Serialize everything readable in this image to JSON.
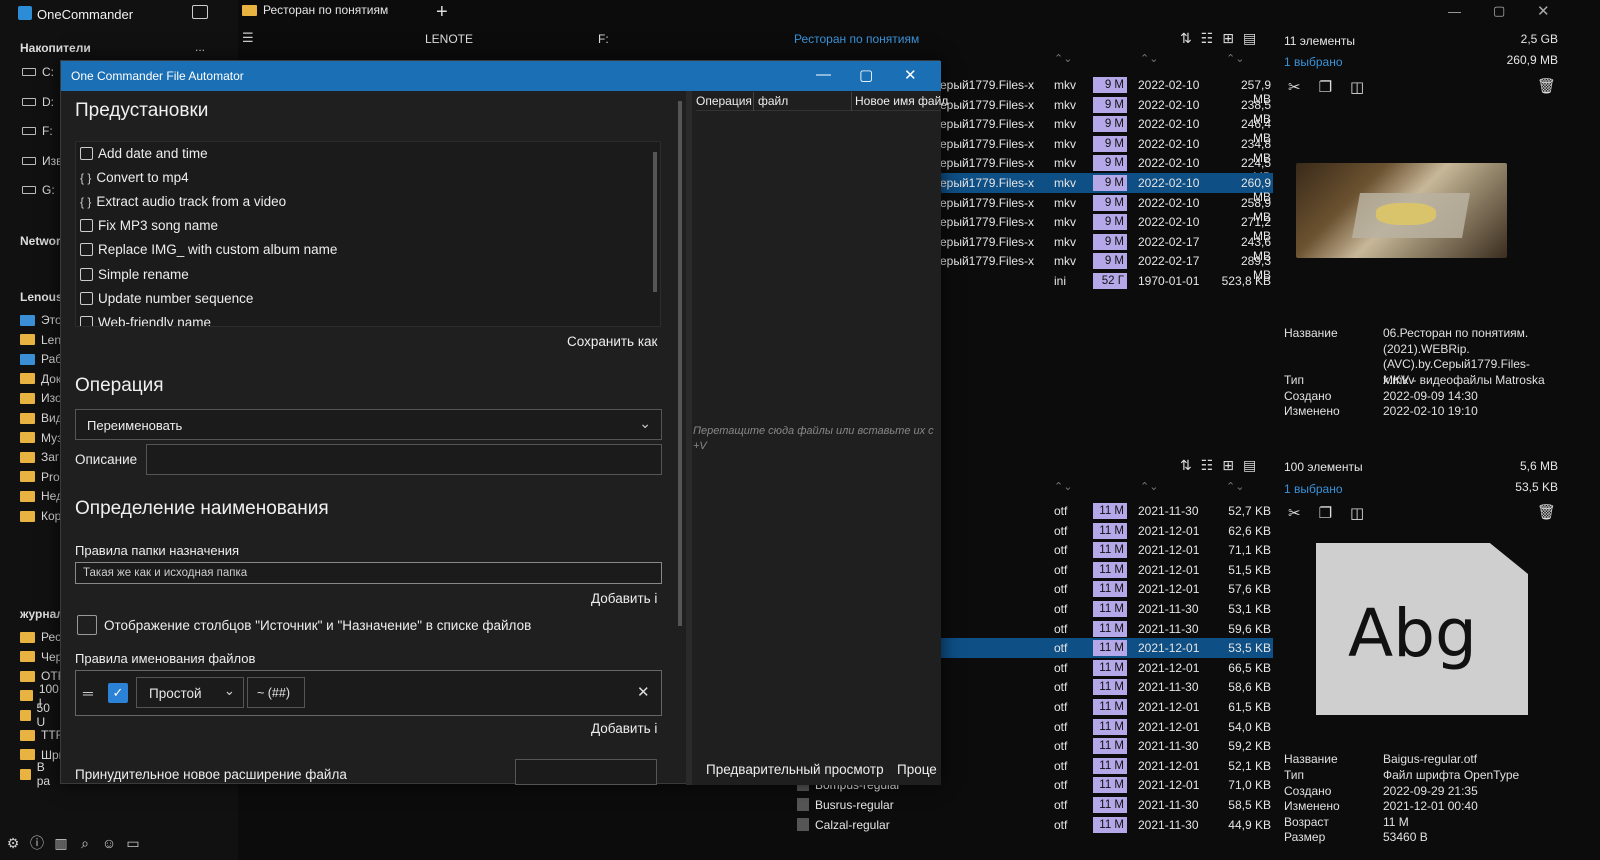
{
  "app": {
    "title": "OneCommander"
  },
  "sidebar": {
    "drives_header": "Накопители",
    "drives_more": "...",
    "drives": [
      {
        "letter": "C:"
      },
      {
        "letter": "D:"
      },
      {
        "letter": "F:"
      },
      {
        "letter": "Изв"
      },
      {
        "letter": "G:"
      }
    ],
    "network_header": "Networ",
    "pc_header": "Lenous",
    "pc_items": [
      "Этот",
      "Leno",
      "Рабо",
      "Доку",
      "Изоб",
      "Виде",
      "Музы",
      "Загр",
      "Prog",
      "Недa",
      "Корз"
    ],
    "journal_header": "журнал",
    "journal_items": [
      "Рест",
      "Черн",
      "OTF",
      "100 l",
      "50 U",
      "TTF-",
      "Шри",
      "В ра"
    ]
  },
  "tabs": [
    {
      "label": "Ресторан по понятиям"
    }
  ],
  "panes": {
    "col1": "LENOTE",
    "col2": "F:",
    "col3_path": "Ресторан по понятиям"
  },
  "top_list": {
    "count": "11 элементы",
    "selected": "1 выбрано",
    "total_size": "2,5 GB",
    "sel_size": "260,9 MB",
    "rows": [
      {
        "name": "ерый1779.Files-x",
        "ext": "mkv",
        "age": "9 M",
        "date": "2022-02-10",
        "size": "257,9 MB",
        "sel": false
      },
      {
        "name": "ерый1779.Files-x",
        "ext": "mkv",
        "age": "9 M",
        "date": "2022-02-10",
        "size": "238,5 MB",
        "sel": false
      },
      {
        "name": "ерый1779.Files-x",
        "ext": "mkv",
        "age": "9 M",
        "date": "2022-02-10",
        "size": "246,4 MB",
        "sel": false
      },
      {
        "name": "ерый1779.Files-x",
        "ext": "mkv",
        "age": "9 M",
        "date": "2022-02-10",
        "size": "234,8 MB",
        "sel": false
      },
      {
        "name": "ерый1779.Files-x",
        "ext": "mkv",
        "age": "9 M",
        "date": "2022-02-10",
        "size": "224,5 MB",
        "sel": false
      },
      {
        "name": "ерый1779.Files-x",
        "ext": "mkv",
        "age": "9 M",
        "date": "2022-02-10",
        "size": "260,9 MB",
        "sel": true
      },
      {
        "name": "ерый1779.Files-x",
        "ext": "mkv",
        "age": "9 M",
        "date": "2022-02-10",
        "size": "258,9 MB",
        "sel": false
      },
      {
        "name": "ерый1779.Files-x",
        "ext": "mkv",
        "age": "9 M",
        "date": "2022-02-10",
        "size": "271,2 MB",
        "sel": false
      },
      {
        "name": "ерый1779.Files-x",
        "ext": "mkv",
        "age": "9 M",
        "date": "2022-02-17",
        "size": "243,6 MB",
        "sel": false
      },
      {
        "name": "ерый1779.Files-x",
        "ext": "mkv",
        "age": "9 M",
        "date": "2022-02-17",
        "size": "289,3 MB",
        "sel": false
      },
      {
        "name": "",
        "ext": "ini",
        "age": "52 Г",
        "date": "1970-01-01",
        "size": "523,8 KB",
        "sel": false
      }
    ]
  },
  "top_info": {
    "name_label": "Название",
    "name_value": "06.Ресторан по понятиям. (2021).WEBRip. (AVC).by.Серый1779.Files-x.mkv",
    "type_label": "Тип",
    "type_value": "MKV - видеофайлы Matroska",
    "created_label": "Создано",
    "created_value": "2022-09-09  14:30",
    "modified_label": "Изменено",
    "modified_value": "2022-02-10  19:10"
  },
  "bottom_list": {
    "count": "100 элементы",
    "selected": "1 выбрано",
    "total_size": "5,6 MB",
    "sel_size": "53,5 KB",
    "rows": [
      {
        "name": "",
        "ext": "otf",
        "age": "11 M",
        "date": "2021-11-30",
        "size": "52,7 KB",
        "sel": false
      },
      {
        "name": "",
        "ext": "otf",
        "age": "11 M",
        "date": "2021-12-01",
        "size": "62,6 KB",
        "sel": false
      },
      {
        "name": "",
        "ext": "otf",
        "age": "11 M",
        "date": "2021-12-01",
        "size": "71,1 KB",
        "sel": false
      },
      {
        "name": "",
        "ext": "otf",
        "age": "11 M",
        "date": "2021-12-01",
        "size": "51,5 KB",
        "sel": false
      },
      {
        "name": "",
        "ext": "otf",
        "age": "11 M",
        "date": "2021-12-01",
        "size": "57,6 KB",
        "sel": false
      },
      {
        "name": "",
        "ext": "otf",
        "age": "11 M",
        "date": "2021-11-30",
        "size": "53,1 KB",
        "sel": false
      },
      {
        "name": "",
        "ext": "otf",
        "age": "11 M",
        "date": "2021-11-30",
        "size": "59,6 KB",
        "sel": false
      },
      {
        "name": "",
        "ext": "otf",
        "age": "11 M",
        "date": "2021-12-01",
        "size": "53,5 KB",
        "sel": true
      },
      {
        "name": "",
        "ext": "otf",
        "age": "11 M",
        "date": "2021-12-01",
        "size": "66,5 KB",
        "sel": false
      },
      {
        "name": "",
        "ext": "otf",
        "age": "11 M",
        "date": "2021-11-30",
        "size": "58,6 KB",
        "sel": false
      },
      {
        "name": "",
        "ext": "otf",
        "age": "11 M",
        "date": "2021-12-01",
        "size": "61,5 KB",
        "sel": false
      },
      {
        "name": "",
        "ext": "otf",
        "age": "11 M",
        "date": "2021-12-01",
        "size": "54,0 KB",
        "sel": false
      },
      {
        "name": "",
        "ext": "otf",
        "age": "11 M",
        "date": "2021-11-30",
        "size": "59,2 KB",
        "sel": false
      },
      {
        "name": "",
        "ext": "otf",
        "age": "11 M",
        "date": "2021-12-01",
        "size": "52,1 KB",
        "sel": false
      },
      {
        "name": "Bompus-regular",
        "ext": "otf",
        "age": "11 M",
        "date": "2021-12-01",
        "size": "71,0 KB",
        "sel": false
      },
      {
        "name": "Busrus-regular",
        "ext": "otf",
        "age": "11 M",
        "date": "2021-11-30",
        "size": "58,5 KB",
        "sel": false
      },
      {
        "name": "Calzal-regular",
        "ext": "otf",
        "age": "11 M",
        "date": "2021-11-30",
        "size": "44,9 KB",
        "sel": false
      }
    ]
  },
  "bottom_info": {
    "preview_text": "Abg",
    "name_label": "Название",
    "name_value": "Baigus-regular.otf",
    "type_label": "Тип",
    "type_value": "Файл шрифта OpenType",
    "created_label": "Создано",
    "created_value": "2022-09-29  21:35",
    "modified_label": "Изменено",
    "modified_value": "2021-12-01  00:40",
    "age_label": "Возраст",
    "age_value": "11 M",
    "size_label": "Размер",
    "size_value": "53460 B"
  },
  "dialog": {
    "title": "One Commander File Automator",
    "presets_title": "Предустановки",
    "presets": [
      {
        "icon": "page-icon",
        "label": "Add date and time"
      },
      {
        "icon": "braces-icon",
        "label": "Convert to mp4"
      },
      {
        "icon": "braces-icon",
        "label": "Extract audio track from a video"
      },
      {
        "icon": "page-icon",
        "label": "Fix MP3 song name"
      },
      {
        "icon": "page-icon",
        "label": "Replace IMG_ with custom album name"
      },
      {
        "icon": "page-icon",
        "label": "Simple rename"
      },
      {
        "icon": "page-icon",
        "label": "Update number sequence"
      },
      {
        "icon": "page-icon",
        "label": "Web-friendly name"
      }
    ],
    "save_as": "Сохранить как",
    "operation_title": "Операция",
    "operation_value": "Переименовать",
    "description_label": "Описание",
    "naming_title": "Определение наименования",
    "dest_rules_label": "Правила папки назначения",
    "dest_rules_value": "Такая же как и исходная папка",
    "add_link_1": "Добавить і",
    "show_columns_label": "Отображение столбцов \"Источник\" и \"Назначение\" в списке файлов",
    "file_rules_label": "Правила именования файлов",
    "rule_type": "Простой",
    "rule_pattern": "~ (##)",
    "add_link_2": "Добавить і",
    "force_ext_label": "Принудительное новое расширение файла",
    "grid_cols": [
      "Операция",
      "файл",
      "Новое имя файл"
    ],
    "drop_hint": "Перетащите сюда файлы или вставьте их с +V",
    "preview_btn": "Предварительный просмотр",
    "process_btn": "Проце"
  }
}
